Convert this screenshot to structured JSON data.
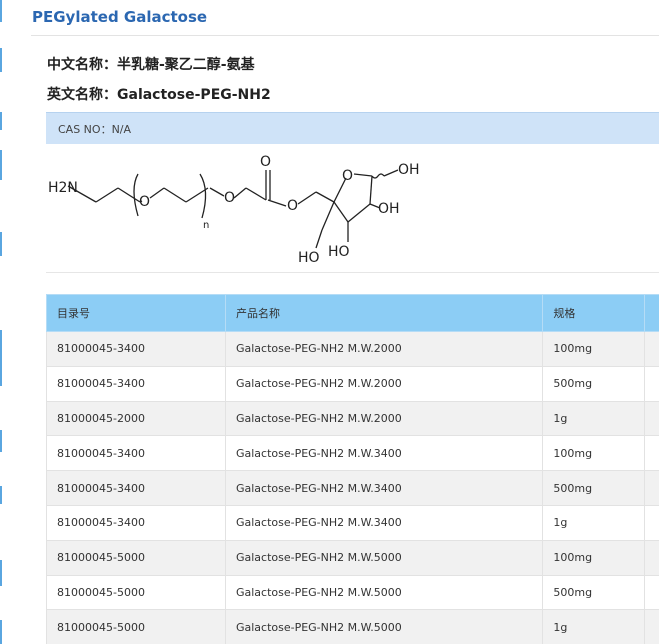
{
  "page": {
    "title": "PEGylated Galactose",
    "chinese_name_label": "中文名称：",
    "chinese_name": "半乳糖-聚乙二醇-氨基",
    "english_name_label": "英文名称：",
    "english_name": "Galactose-PEG-NH2",
    "cas": "CAS NO：N/A"
  },
  "structure": {
    "amine": "H2N",
    "subscript_n": "n",
    "oxygen": "O",
    "oh_labels": [
      "OH",
      "OH",
      "HO",
      "HO"
    ]
  },
  "table": {
    "headers": [
      "目录号",
      "产品名称",
      "规格"
    ],
    "rows": [
      [
        "81000045-3400",
        "Galactose-PEG-NH2 M.W.2000",
        "100mg"
      ],
      [
        "81000045-3400",
        "Galactose-PEG-NH2 M.W.2000",
        "500mg"
      ],
      [
        "81000045-2000",
        "Galactose-PEG-NH2 M.W.2000",
        "1g"
      ],
      [
        "81000045-3400",
        "Galactose-PEG-NH2 M.W.3400",
        "100mg"
      ],
      [
        "81000045-3400",
        "Galactose-PEG-NH2 M.W.3400",
        "500mg"
      ],
      [
        "81000045-3400",
        "Galactose-PEG-NH2 M.W.3400",
        "1g"
      ],
      [
        "81000045-5000",
        "Galactose-PEG-NH2 M.W.5000",
        "100mg"
      ],
      [
        "81000045-5000",
        "Galactose-PEG-NH2 M.W.5000",
        "500mg"
      ],
      [
        "81000045-5000",
        "Galactose-PEG-NH2 M.W.5000",
        "1g"
      ]
    ]
  },
  "colors": {
    "title": "#2b67b1",
    "cas_bar": "#cfe3f8",
    "table_header": "#8ccdf5",
    "row_alt": "#f1f1f1",
    "sidebar_accent": "#5aa6e0"
  }
}
